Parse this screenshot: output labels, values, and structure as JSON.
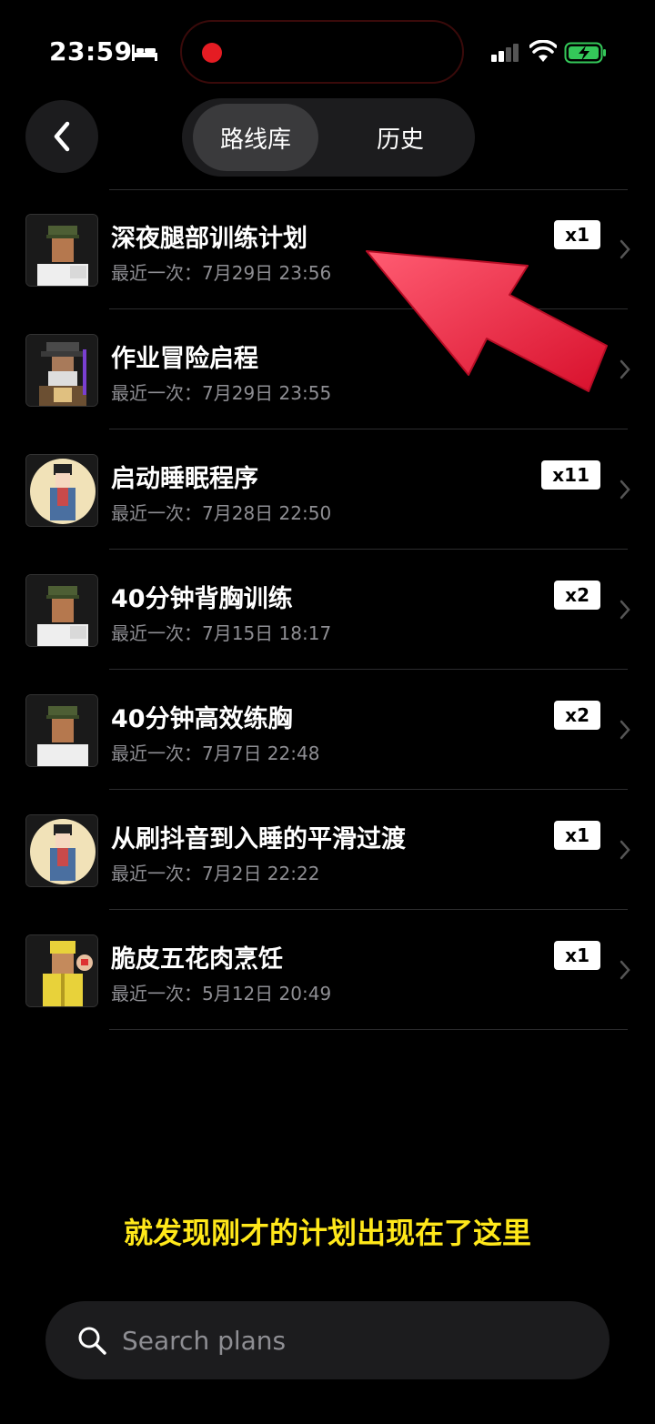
{
  "status_bar": {
    "time": "23:59",
    "recording": true
  },
  "nav": {
    "tabs": [
      {
        "label": "路线库",
        "active": true
      },
      {
        "label": "历史",
        "active": false
      }
    ]
  },
  "plans": [
    {
      "title": "深夜腿部训练计划",
      "last": "最近一次：7月29日 23:56",
      "count": "x1",
      "avatar": "soldier-avatar"
    },
    {
      "title": "作业冒险启程",
      "last": "最近一次：7月29日 23:55",
      "count": "",
      "avatar": "wizard-avatar"
    },
    {
      "title": "启动睡眠程序",
      "last": "最近一次：7月28日 22:50",
      "count": "x11",
      "avatar": "lady-avatar"
    },
    {
      "title": "40分钟背胸训练",
      "last": "最近一次：7月15日 18:17",
      "count": "x2",
      "avatar": "soldier-avatar"
    },
    {
      "title": "40分钟高效练胸",
      "last": "最近一次：7月7日 22:48",
      "count": "x2",
      "avatar": "soldier-avatar"
    },
    {
      "title": "从刷抖音到入睡的平滑过渡",
      "last": "最近一次：7月2日 22:22",
      "count": "x1",
      "avatar": "lady-avatar"
    },
    {
      "title": "脆皮五花肉烹饪",
      "last": "最近一次：5月12日 20:49",
      "count": "x1",
      "avatar": "chef-avatar"
    }
  ],
  "caption": "就发现刚才的计划出现在了这里",
  "search": {
    "placeholder": "Search plans",
    "value": ""
  },
  "colors": {
    "caption": "#ffe81a",
    "arrow": "#e8233f",
    "recording": "#e51c23",
    "battery": "#34c759"
  }
}
